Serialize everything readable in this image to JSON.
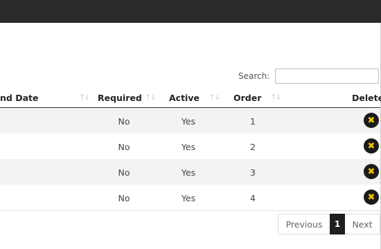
{
  "search": {
    "label": "Search:",
    "value": "",
    "placeholder": ""
  },
  "table": {
    "columns": [
      {
        "label": "nd Date"
      },
      {
        "label": "Required"
      },
      {
        "label": "Active"
      },
      {
        "label": "Order"
      },
      {
        "label": "Delete"
      }
    ],
    "rows": [
      {
        "required": "No",
        "active": "Yes",
        "order": "1"
      },
      {
        "required": "No",
        "active": "Yes",
        "order": "2"
      },
      {
        "required": "No",
        "active": "Yes",
        "order": "3"
      },
      {
        "required": "No",
        "active": "Yes",
        "order": "4"
      }
    ],
    "sort_icon": "↑↓",
    "delete_icon": "✖"
  },
  "pagination": {
    "previous": "Previous",
    "current": "1",
    "next": "Next"
  },
  "colors": {
    "topbar": "#2b2b2b",
    "delete_icon": "#f2c200",
    "active_page": "#1f1f1f"
  }
}
